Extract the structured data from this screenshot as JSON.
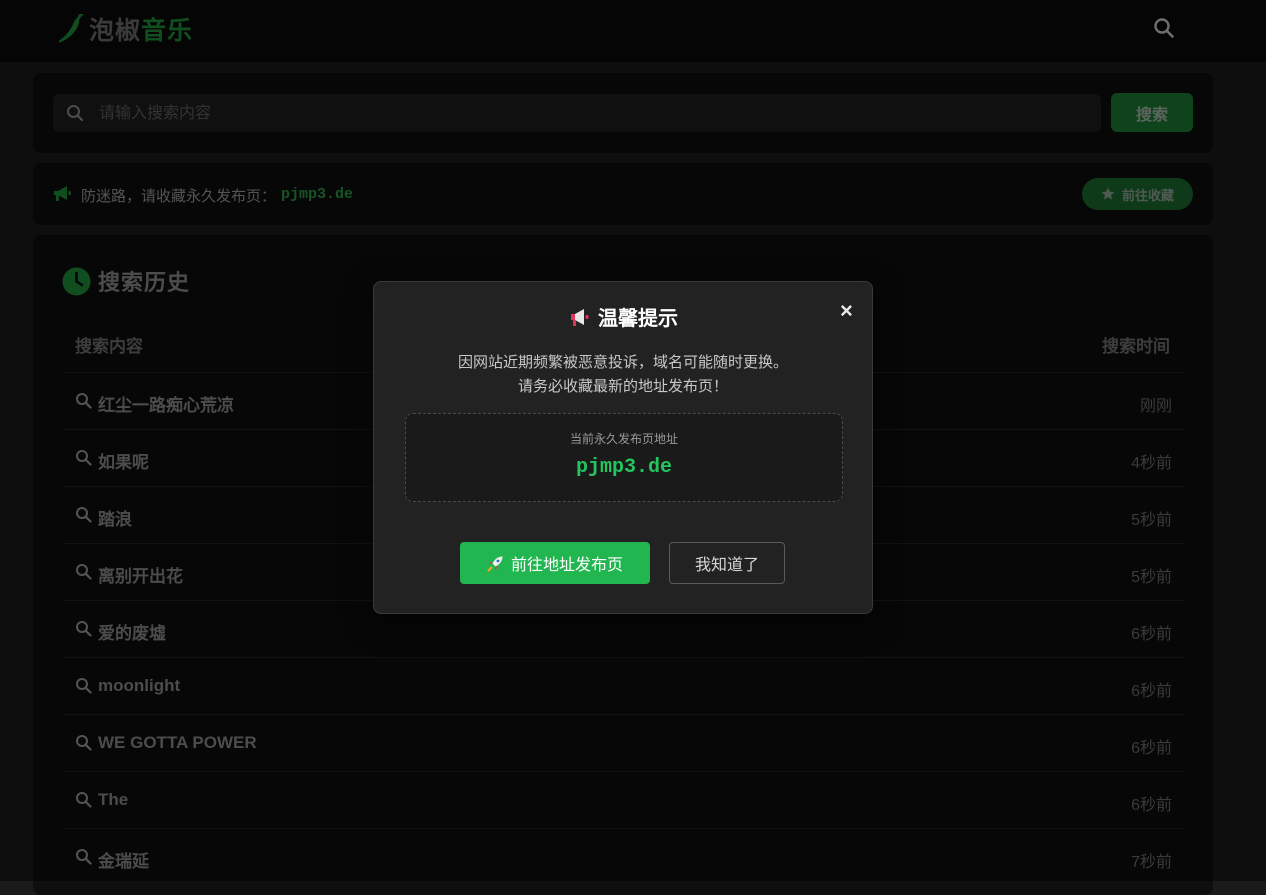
{
  "header": {
    "logo_part1": "泡椒",
    "logo_part2": "音乐",
    "search_icon": "search-icon"
  },
  "search": {
    "placeholder": "请输入搜索内容",
    "value": "",
    "button_label": "搜索"
  },
  "notice": {
    "icon": "megaphone-icon",
    "text": "防迷路，请收藏永久发布页：",
    "domain": "pjmp3.de",
    "favorite_label": "前往收藏",
    "favorite_icon": "star-icon"
  },
  "history": {
    "title": "搜索历史",
    "title_icon": "clock-icon",
    "col_query": "搜索内容",
    "col_time": "搜索时间",
    "rows": [
      {
        "query": "红尘一路痴心荒凉",
        "time": "刚刚"
      },
      {
        "query": "如果呢",
        "time": "4秒前"
      },
      {
        "query": "踏浪",
        "time": "5秒前"
      },
      {
        "query": "离别开出花",
        "time": "5秒前"
      },
      {
        "query": "爱的废墟",
        "time": "6秒前"
      },
      {
        "query": "moonlight",
        "time": "6秒前"
      },
      {
        "query": "WE GOTTA POWER",
        "time": "6秒前"
      },
      {
        "query": "The",
        "time": "6秒前"
      },
      {
        "query": "金瑞延",
        "time": "7秒前"
      }
    ]
  },
  "modal": {
    "title": "温馨提示",
    "title_icon": "megaphone-icon",
    "close": "×",
    "line1": "因网站近期频繁被恶意投诉，域名可能随时更换。",
    "line2": "请务必收藏最新的地址发布页！",
    "box_label": "当前永久发布页地址",
    "box_domain": "pjmp3.de",
    "go_label": "前往地址发布页",
    "go_icon": "rocket-icon",
    "ok_label": "我知道了"
  },
  "colors": {
    "accent": "#22b651",
    "brand_green": "#1f8f3a",
    "background": "#1b1b1b",
    "panel": "#0e0e0e"
  }
}
